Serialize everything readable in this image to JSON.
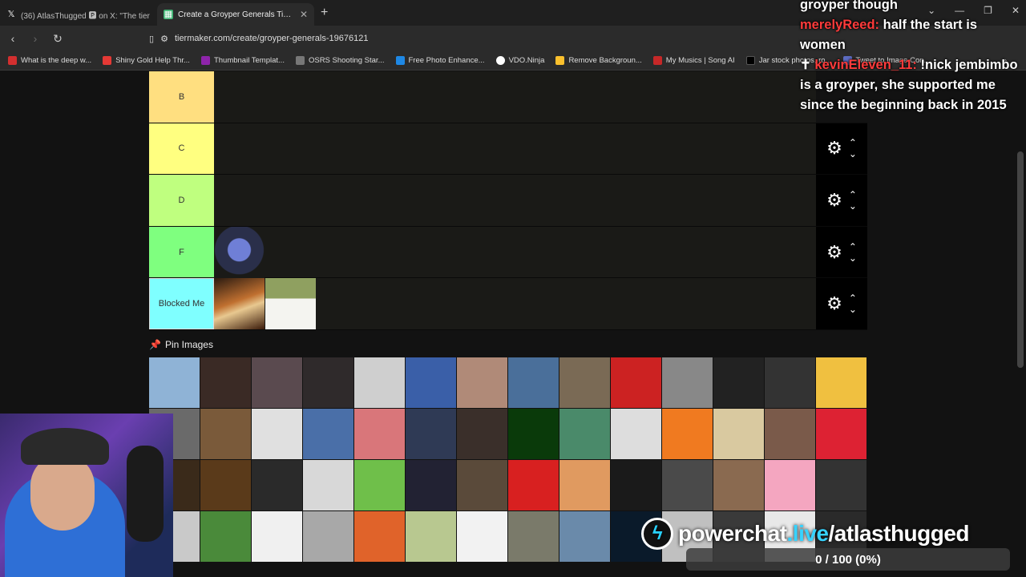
{
  "tabs": [
    {
      "label": "(36) AtlasThugged 🅿 on X: \"The tier",
      "icon": "x-icon"
    },
    {
      "label": "Create a Groyper Generals Tier List",
      "icon": "tiermaker-icon"
    }
  ],
  "url": "tiermaker.com/create/groyper-generals-19676121",
  "bookmarks": [
    {
      "label": "What is the deep w...",
      "color": "#d32f2f"
    },
    {
      "label": "Shiny Gold Help Thr...",
      "color": "#e53935"
    },
    {
      "label": "Thumbnail Templat...",
      "color": "#8e24aa"
    },
    {
      "label": "OSRS Shooting Star...",
      "color": "#777777"
    },
    {
      "label": "Free Photo Enhance...",
      "color": "#1e88e5"
    },
    {
      "label": "VDO.Ninja",
      "color": "#ffffff"
    },
    {
      "label": "Remove Backgroun...",
      "color": "#fbc02d"
    },
    {
      "label": "My Musics | Song AI",
      "color": "#c62828"
    },
    {
      "label": "Jar stock photos, ro...",
      "color": "#000000"
    },
    {
      "label": "Tweet to Image Con...",
      "color": "#5c6bc0"
    }
  ],
  "tiers": [
    {
      "label": "B",
      "color": "#ffdf80",
      "items": []
    },
    {
      "label": "C",
      "color": "#ffff80",
      "items": []
    },
    {
      "label": "D",
      "color": "#bfff7f",
      "items": []
    },
    {
      "label": "F",
      "color": "#7fff7f",
      "items": [
        "spider"
      ]
    },
    {
      "label": "Blocked Me",
      "color": "#7fffff",
      "items": [
        "woman-fire",
        "woman-white-dress"
      ]
    }
  ],
  "pin_images_label": "Pin Images",
  "chat": [
    {
      "user": "",
      "text": "groyper though"
    },
    {
      "user": "merelyReed:",
      "text": " half the start is women"
    },
    {
      "user": "kevinEleven_11:",
      "text": " !nick jembimbo is a groyper, she supported me since the beginning back in 2015"
    }
  ],
  "promo": {
    "prefix": "powerchat",
    "highlight": ".live",
    "suffix": "/atlasthugged"
  },
  "progress": "0 / 100 (0%)",
  "grid_colors": [
    "#8fb3d6",
    "#3a2a25",
    "#5a4a4f",
    "#2f2a2b",
    "#cfcfcf",
    "#3a5fa8",
    "#b08a78",
    "#4a6f9a",
    "#7a6a55",
    "#c22",
    "#888",
    "#222",
    "#333",
    "#f0c040",
    "#6a6a6a",
    "#7a5a3a",
    "#e0e0e0",
    "#4a6fa8",
    "#d9767a",
    "#2f3a55",
    "#3a2f2a",
    "#0a3a0a",
    "#4a8a6a",
    "#ddd",
    "#f07a20",
    "#d9c9a0",
    "#7a5a4a",
    "#d23",
    "#3a2a1a",
    "#5a3a1a",
    "#2a2a2a",
    "#d8d8d8",
    "#6fbf4a",
    "#223",
    "#5a4a3a",
    "#d82020",
    "#e09a60",
    "#1a1a1a",
    "#4a4a4a",
    "#8a6a50",
    "#f4a6c0",
    "#333",
    "#c9c9c9",
    "#4a8a3a",
    "#f0f0f0",
    "#a8a8a8",
    "#e0632a",
    "#b8c890",
    "#f2f2f2",
    "#7a7a6a",
    "#6a8aaa",
    "#0a1a2a",
    "#c0c0c0",
    "#3a3a3a",
    "#e8e8e8",
    "#2a2a2a"
  ]
}
